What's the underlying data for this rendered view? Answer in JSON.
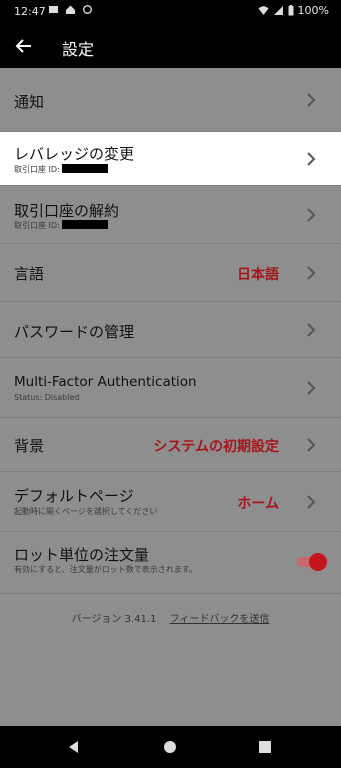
{
  "status_bar": {
    "time": "12:47",
    "battery": "100%"
  },
  "header": {
    "title": "設定"
  },
  "settings": [
    {
      "label": "通知"
    },
    {
      "label": "レバレッジの変更",
      "sub": "取引口座 ID:"
    },
    {
      "label": "取引口座の解約",
      "sub": "取引口座 ID:"
    },
    {
      "label": "言語",
      "value": "日本語"
    },
    {
      "label": "パスワードの管理"
    },
    {
      "label": "Multi-Factor Authentication",
      "sub": "Status: Disabled"
    },
    {
      "label": "背景",
      "value": "システムの初期設定"
    },
    {
      "label": "デフォルトページ",
      "sub": "起動時に開くページを選択してください",
      "value": "ホーム"
    },
    {
      "label": "ロット単位の注文量",
      "sub": "有効にすると、注文量がロット数で表示されます。",
      "toggle_on": true
    }
  ],
  "footer": {
    "version": "バージョン 3.41.1",
    "feedback": "フィードバックを送信"
  },
  "colors": {
    "accent": "#c4171d",
    "background": "#8e8e8e",
    "highlight_row": "#ffffff"
  }
}
